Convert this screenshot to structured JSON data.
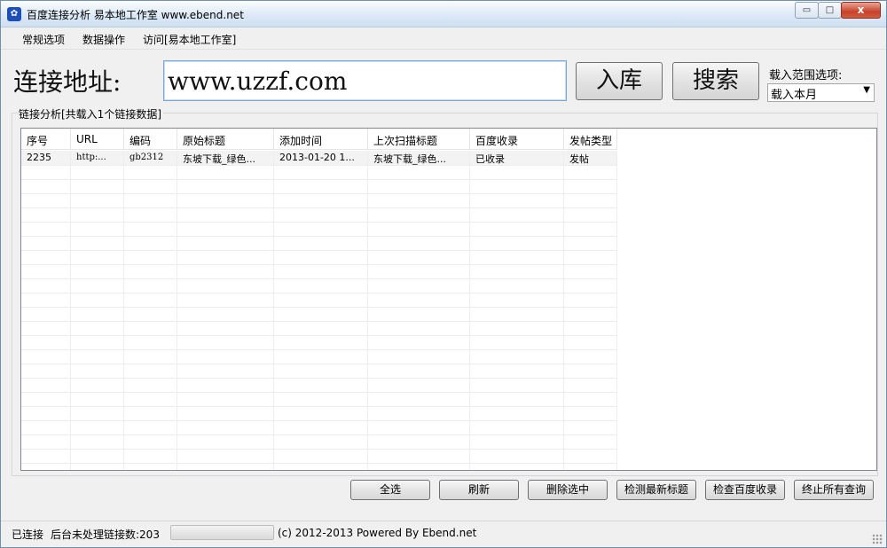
{
  "window": {
    "title": "百度连接分析 易本地工作室 www.ebend.net",
    "minimize": "▭",
    "maximize": "□",
    "close": "x"
  },
  "menu": [
    "常规选项",
    "数据操作",
    "访问[易本地工作室]"
  ],
  "form": {
    "label": "连接地址:",
    "url_value": "www.uzzf.com",
    "insert_button": "入库",
    "search_button": "搜索",
    "range_label": "载入范围选项:",
    "range_selected": "载入本月"
  },
  "group": {
    "label": "链接分析[共载入1个链接数据]"
  },
  "table": {
    "columns": [
      "序号",
      "URL",
      "编码",
      "原始标题",
      "添加时间",
      "上次扫描标题",
      "百度收录",
      "发帖类型"
    ],
    "rows": [
      [
        "2235",
        "http:...",
        "gb2312",
        "东坡下载_绿色...",
        "2013-01-20 1...",
        "东坡下载_绿色...",
        "已收录",
        "发帖"
      ]
    ]
  },
  "actions": [
    "全选",
    "刷新",
    "删除选中",
    "检测最新标题",
    "检查百度收录",
    "终止所有查询"
  ],
  "status": {
    "connection": "已连接",
    "pending": "后台未处理链接数:203",
    "copyright": "(c) 2012-2013 Powered By Ebend.net"
  }
}
